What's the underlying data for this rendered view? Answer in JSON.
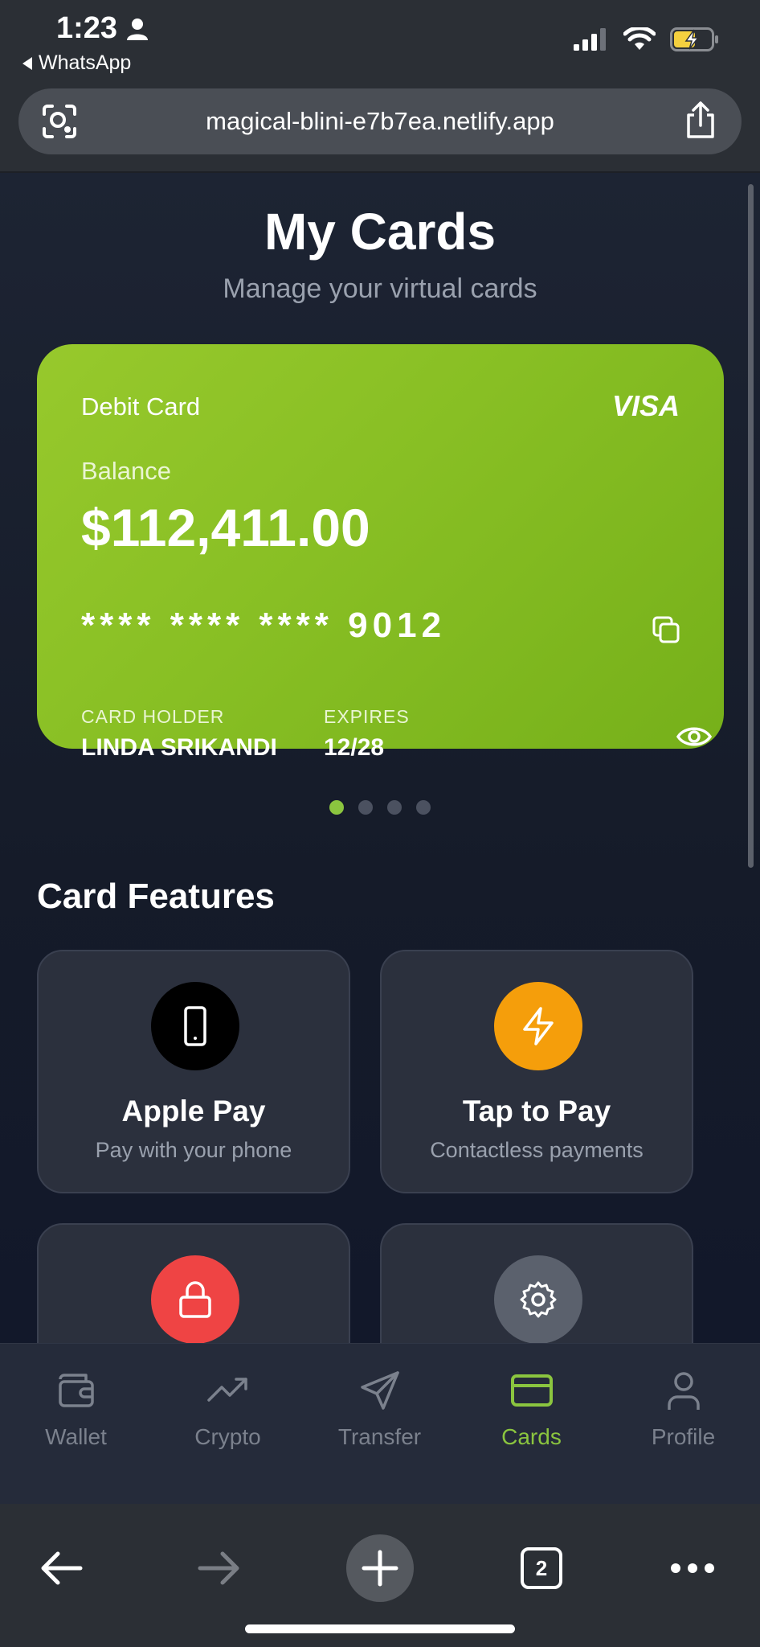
{
  "status": {
    "time": "1:23",
    "back_app": "WhatsApp"
  },
  "browser": {
    "url": "magical-blini-e7b7ea.netlify.app",
    "tab_count": "2"
  },
  "header": {
    "title": "My Cards",
    "subtitle": "Manage your virtual cards"
  },
  "card": {
    "type": "Debit Card",
    "brand": "VISA",
    "balance_label": "Balance",
    "balance": "$112,411.00",
    "number": "**** **** **** 9012",
    "holder_label": "CARD HOLDER",
    "holder_name": "LINDA SRIKANDI",
    "expires_label": "EXPIRES",
    "expires": "12/28",
    "color": "#8bc53f"
  },
  "carousel": {
    "count": 4,
    "active_index": 0
  },
  "features": {
    "title": "Card Features",
    "items": [
      {
        "title": "Apple Pay",
        "desc": "Pay with your phone",
        "icon": "phone-icon",
        "color": "#000000"
      },
      {
        "title": "Tap to Pay",
        "desc": "Contactless payments",
        "icon": "bolt-icon",
        "color": "#f59e0b"
      },
      {
        "title": "",
        "desc": "",
        "icon": "lock-icon",
        "color": "#ef4444"
      },
      {
        "title": "",
        "desc": "",
        "icon": "gear-icon",
        "color": "#5b616d"
      }
    ]
  },
  "tabbar": {
    "items": [
      {
        "label": "Wallet",
        "icon": "wallet-icon"
      },
      {
        "label": "Crypto",
        "icon": "trending-icon"
      },
      {
        "label": "Transfer",
        "icon": "send-icon"
      },
      {
        "label": "Cards",
        "icon": "card-icon",
        "active": true
      },
      {
        "label": "Profile",
        "icon": "user-icon"
      }
    ],
    "active_color": "#8bc53f"
  }
}
